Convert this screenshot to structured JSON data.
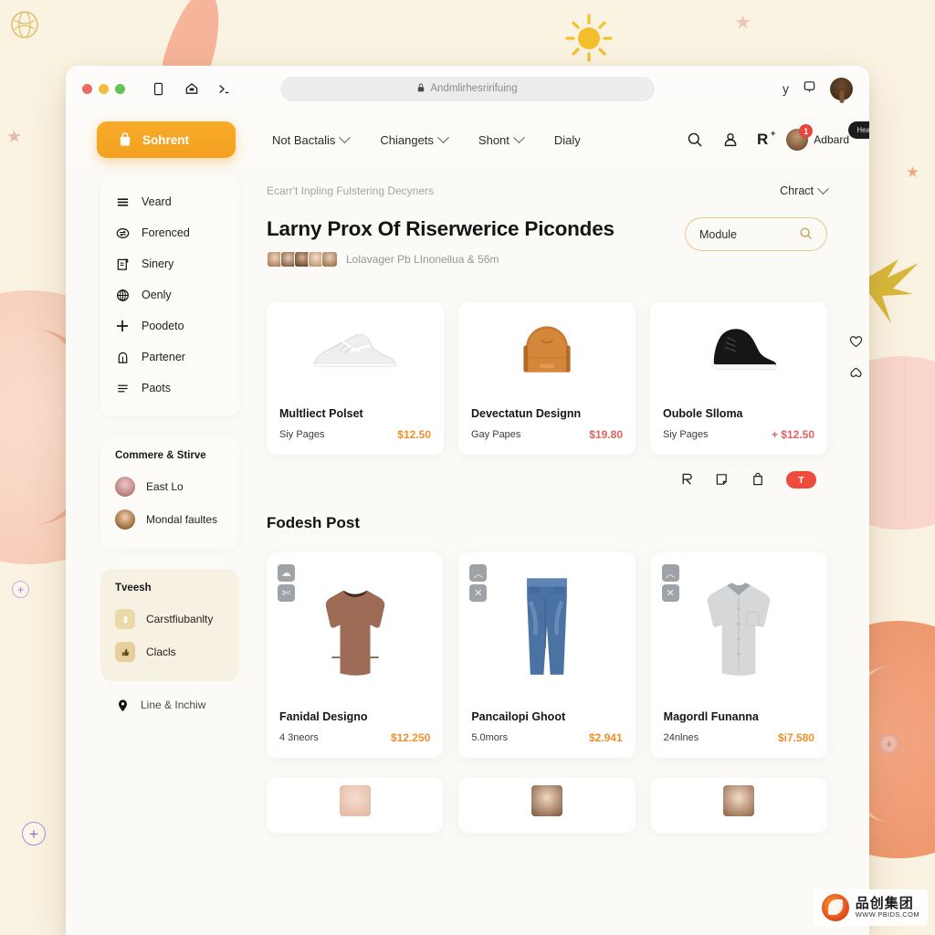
{
  "browser": {
    "url": "Andmlirhesririfuing",
    "lock_icon": "lock-icon",
    "toolbar_icons": [
      "tablet-icon",
      "home-icon",
      "terminal-icon"
    ],
    "right_icons": [
      "y-icon",
      "cast-icon"
    ]
  },
  "nav": {
    "brand": "Sohrent",
    "brand_icon": "bag-icon",
    "links": [
      {
        "label": "Not Bactalis",
        "has_chevron": true
      },
      {
        "label": "Chiangets",
        "has_chevron": true
      },
      {
        "label": "Shont",
        "has_chevron": true
      },
      {
        "label": "Dialy",
        "has_chevron": false
      }
    ],
    "icons": [
      "search-icon",
      "user-icon"
    ],
    "glyph": "R",
    "glyph_sup": "+",
    "user": {
      "name": "Adbard",
      "badge": "1",
      "pill": "Hea"
    }
  },
  "sidebar": {
    "items": [
      {
        "label": "Veard",
        "icon": "menu-icon"
      },
      {
        "label": "Forenced",
        "icon": "swap-icon"
      },
      {
        "label": "Sinery",
        "icon": "clipboard-icon"
      },
      {
        "label": "Oenly",
        "icon": "globe-icon"
      },
      {
        "label": "Poodeto",
        "icon": "plus-icon"
      },
      {
        "label": "Partener",
        "icon": "lock-icon"
      },
      {
        "label": "Paots",
        "icon": "list-icon"
      }
    ],
    "section_one": {
      "title": "Commere & Stirve",
      "rows": [
        {
          "label": "East Lo",
          "icon": "avatar-icon"
        },
        {
          "label": "Mondal faultes",
          "icon": "avatar-icon"
        }
      ]
    },
    "section_two": {
      "title": "Tveesh",
      "rows": [
        {
          "label": "Carstfiubanlty",
          "icon": "badge-icon"
        },
        {
          "label": "Clacls",
          "icon": "thumb-icon"
        }
      ]
    },
    "footer": {
      "label": "Line & Inchiw",
      "icon": "pin-icon"
    }
  },
  "main": {
    "breadcrumb": "Ecarr't Inpling Fulstering Decyners",
    "breadcrumb_right": "Chract",
    "title": "Larny Prox Of Riserwerice Picondes",
    "meta_text": "Lolavager Pb LInonellua & 56m",
    "search": {
      "value": "Module",
      "icon": "search-icon"
    },
    "side_actions": [
      "heart-icon",
      "share-icon"
    ],
    "bottom_actions": [
      "arrow-icon",
      "note-icon",
      "bag-icon"
    ],
    "bottom_pill": "T",
    "section_title": "Fodesh Post",
    "products_row1": [
      {
        "title": "Multliect Polset",
        "meta": "Siy Pages",
        "price": "$12.50",
        "price_red": false,
        "image": "white-sneaker"
      },
      {
        "title": "Devectatun Designn",
        "meta": "Gay Papes",
        "price": "$19.80",
        "price_red": true,
        "image": "tan-bag"
      },
      {
        "title": "Oubole Slloma",
        "meta": "Siy Pages",
        "price": "+ $12.50",
        "price_red": true,
        "image": "black-sneaker"
      }
    ],
    "products_row2": [
      {
        "title": "Fanidal Designo",
        "meta": "4 3neors",
        "price": "$12.250",
        "image": "brown-sweater",
        "badges": [
          "cloud-icon",
          "cut-icon"
        ]
      },
      {
        "title": "Pancailopi Ghoot",
        "meta": "5.0mors",
        "price": "$2.941",
        "image": "blue-jeans",
        "badges": [
          "chevron-up-icon",
          "close-icon"
        ]
      },
      {
        "title": "Magordl Funanna",
        "meta": "24nlnes",
        "price": "$i7.580",
        "image": "gray-shirt",
        "badges": [
          "chevron-up-icon",
          "close-icon"
        ]
      }
    ],
    "products_row3": [
      {
        "image": "face-1"
      },
      {
        "image": "face-2"
      },
      {
        "image": "face-3"
      }
    ]
  },
  "watermark": {
    "cn": "品创集团",
    "url": "WWW.PBIDS.COM"
  },
  "colors": {
    "brand": "#f2a01f",
    "accent_price": "#ef8f2a",
    "red": "#e0625f",
    "pill": "#ee4b3c"
  }
}
